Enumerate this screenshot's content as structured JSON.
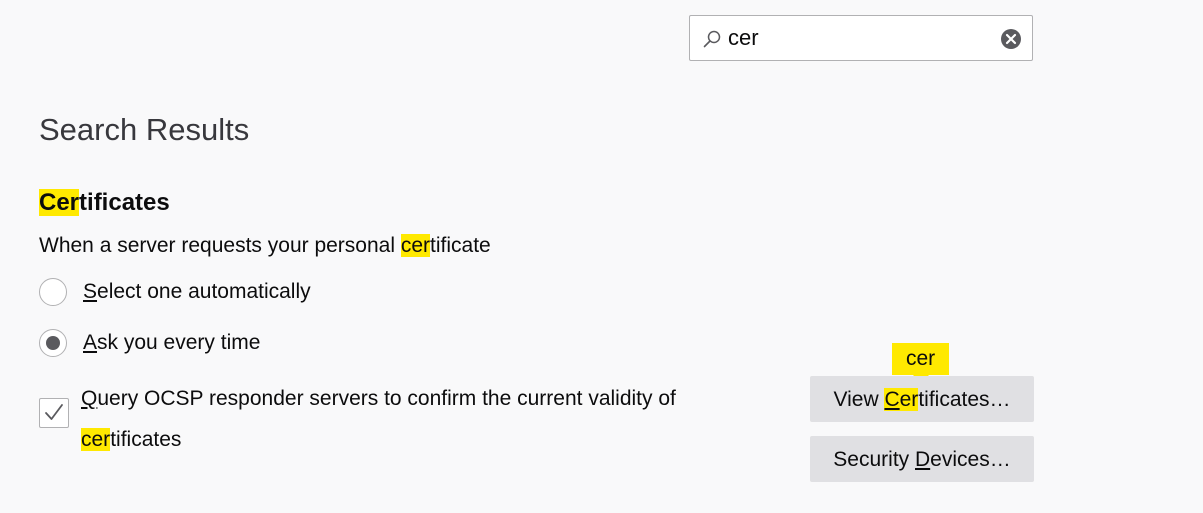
{
  "search": {
    "value": "cer",
    "icon": "search-icon",
    "clear_icon": "clear-icon"
  },
  "results_title": "Search Results",
  "section": {
    "title_hl": "Cer",
    "title_rest": "tificates"
  },
  "description": {
    "before": "When a server requests your personal ",
    "hl": "cer",
    "after": "tificate"
  },
  "options": [
    {
      "mnemonic": "S",
      "rest": "elect one automatically",
      "checked": false
    },
    {
      "mnemonic": "A",
      "rest": "sk you every time",
      "checked": true
    }
  ],
  "ocsp": {
    "checked": true,
    "mnemonic": "Q",
    "line1_rest": "uery OCSP responder servers to confirm the current validity of",
    "line2_hl": "cer",
    "line2_rest": "tificates"
  },
  "buttons": {
    "view_before": "View ",
    "view_hl_underlined": "C",
    "view_hl": "er",
    "view_after": "tificates…",
    "security_before": "Security ",
    "security_mnemonic": "D",
    "security_after": "evices…"
  },
  "tooltip": "cer",
  "colors": {
    "highlight": "#ffe900",
    "background": "#f9f9fa",
    "button": "#e0e0e3"
  }
}
